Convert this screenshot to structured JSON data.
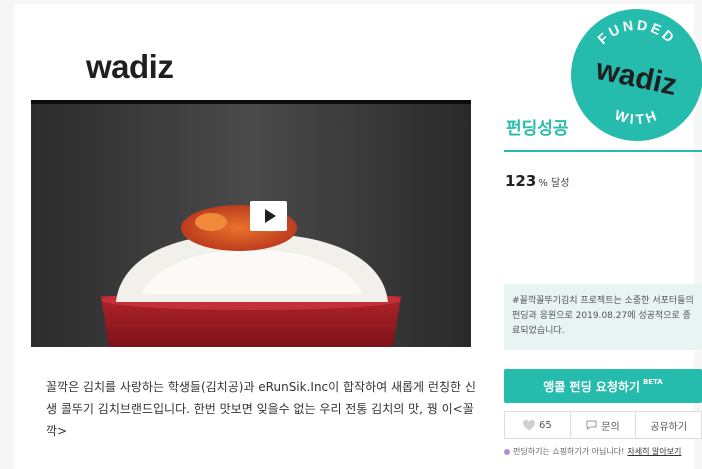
{
  "header": {
    "logo_text": "wadiz"
  },
  "badge": {
    "top_text": "FUNDED",
    "center_text": "wadiz",
    "bottom_text": "WITH"
  },
  "video": {
    "play_icon": "play-icon"
  },
  "project": {
    "description": "꼴깍은 김치를 사랑하는 학생들(김치공)과 eRunSik.Inc이 합작하여 새롭게 런칭한 신생 콜뚜기 김치브랜드입니다. 한번 맛보면 잊을수 없는 우리 전통 김치의 맛, 꿩 이<꼴깍>"
  },
  "funding": {
    "status": "펀딩성공",
    "rate_value": "123",
    "rate_unit": "% 달성",
    "notice": "#꼴깍꼴뚜기김치 프로젝트는 소중한 서포터들의 펀딩과 응원으로 2019.08.27에 성공적으로 종료되었습니다."
  },
  "actions": {
    "encore_label": "앵콜 펀딩 요청하기",
    "encore_badge": "BETA",
    "like_count": "65",
    "inquiry_label": "문의",
    "share_label": "공유하기"
  },
  "footer": {
    "note": "펀딩하기는 쇼핑하기가 아닙니다!",
    "link": "자세히 알아보기"
  },
  "colors": {
    "accent": "#25bcae",
    "notice_bg": "#e7f4f2"
  }
}
